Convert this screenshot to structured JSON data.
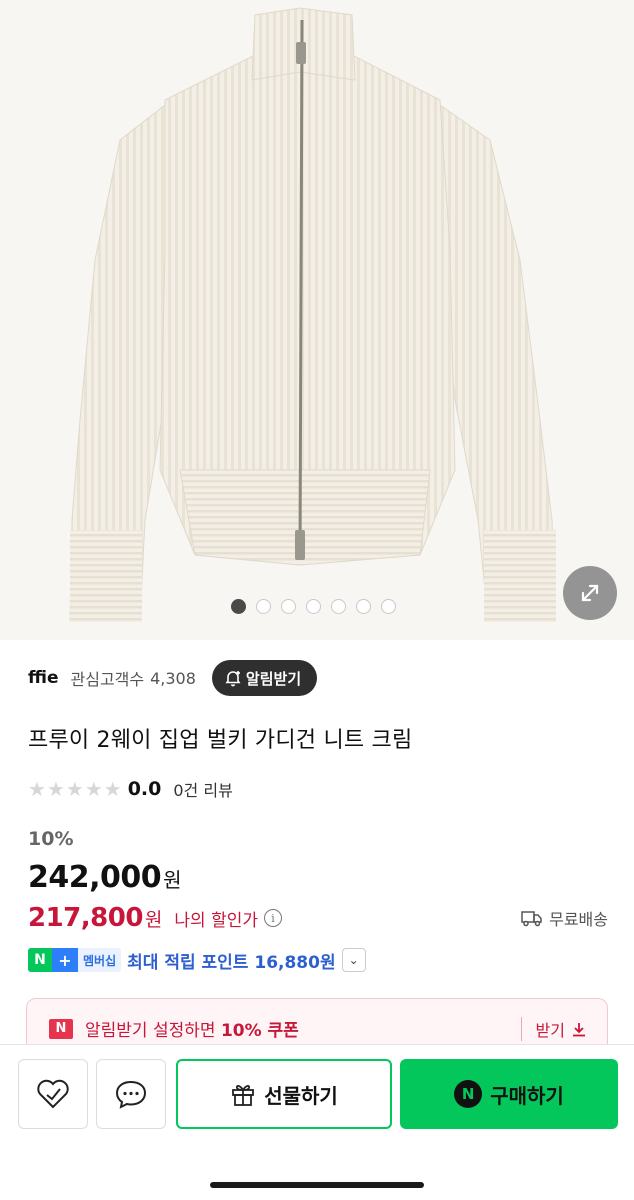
{
  "gallery": {
    "slide_count": 7,
    "active_slide": 1,
    "zoom_icon": "expand-arrows-icon"
  },
  "seller": {
    "name": "ffie",
    "fans_label": "관심고객수",
    "fans_count": "4,308",
    "alarm_label": "알림받기"
  },
  "product": {
    "title": "프루이 2웨이 집업 벌키 가디건 니트 크림",
    "rating_score": "0.0",
    "rating_stars": 0,
    "review_count": "0건 리뷰"
  },
  "price": {
    "discount_rate": "10%",
    "original": "242,000",
    "currency": "원",
    "sale": "217,800",
    "my_discount_label": "나의 할인가",
    "shipping_label": "무료배송"
  },
  "membership": {
    "badge_n": "N",
    "badge_plus": "+",
    "badge_label": "멤버십",
    "text": "최대 적립 포인트 16,880원"
  },
  "coupon": {
    "badge": "N",
    "text_before": "알림받기 설정하면 ",
    "text_bold": "10% 쿠폰",
    "get_label": "받기"
  },
  "actions": {
    "gift_label": "선물하기",
    "buy_label": "구매하기",
    "buy_badge": "N"
  },
  "colors": {
    "naver_green": "#03c75a",
    "sale_red": "#c8163b",
    "member_blue": "#2d5fd0"
  }
}
